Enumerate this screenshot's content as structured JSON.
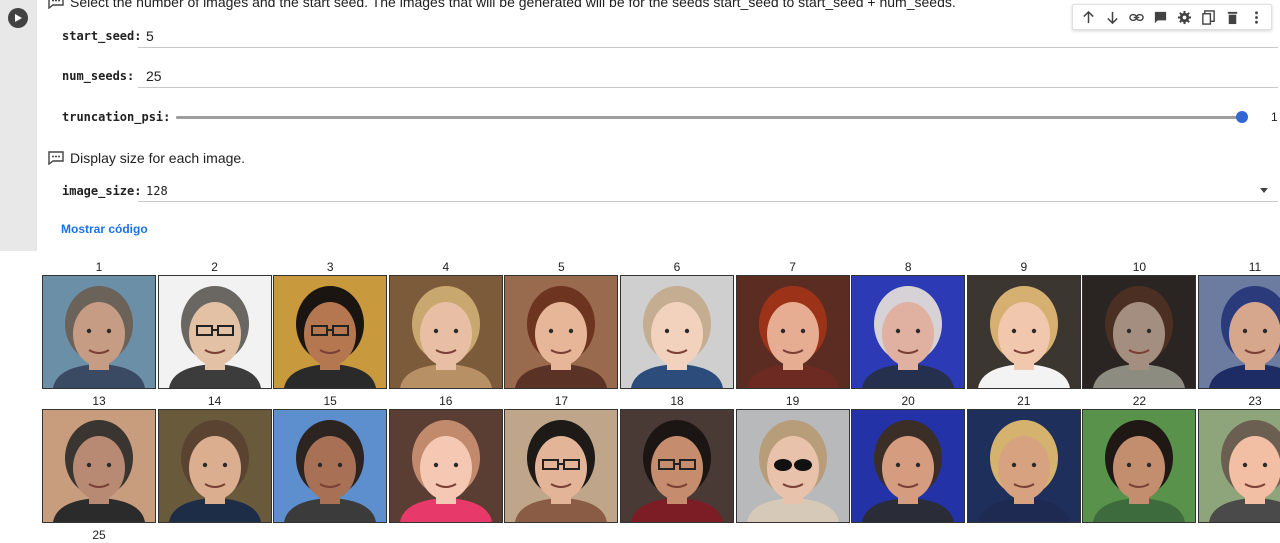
{
  "form": {
    "description_top": "Select the number of images and the start seed. The images that will be generated will be for the seeds start_seed to start_seed + num_seeds.",
    "start_seed_label": "start_seed:",
    "start_seed_value": "5",
    "num_seeds_label": "num_seeds:",
    "num_seeds_value": "25",
    "truncation_label": "truncation_psi:",
    "truncation_value": "1",
    "truncation_level": 1.0,
    "display_desc": "Display size for each image.",
    "image_size_label": "image_size:",
    "image_size_value": "128",
    "show_code": "Mostrar código"
  },
  "toolbar": {
    "icons": [
      "arrow-up-icon",
      "arrow-down-icon",
      "link-icon",
      "comment-icon",
      "settings-icon",
      "mirror-cell-icon",
      "delete-icon",
      "more-icon"
    ]
  },
  "images": {
    "row1": [
      {
        "label": "1",
        "skin": "#c79c84",
        "hair": "#6b6259",
        "bg": "#6c8fa8",
        "shirt": "#3a4a63"
      },
      {
        "label": "2",
        "skin": "#e2c1a4",
        "hair": "#6a6762",
        "bg": "#f2f2f2",
        "shirt": "#3c3c3c",
        "glasses": true
      },
      {
        "label": "3",
        "skin": "#b5774f",
        "hair": "#1b1512",
        "bg": "#c99a3d",
        "shirt": "#2a2a2a",
        "glasses": true
      },
      {
        "label": "4",
        "skin": "#e8bfa5",
        "hair": "#c9a870",
        "bg": "#7c5b3b",
        "shirt": "#b89065"
      },
      {
        "label": "5",
        "skin": "#e7b597",
        "hair": "#6d3520",
        "bg": "#9a6a4e",
        "shirt": "#5b3326"
      },
      {
        "label": "6",
        "skin": "#f2d2bd",
        "hair": "#c4ad90",
        "bg": "#cfcfcf",
        "shirt": "#2c4d7b"
      },
      {
        "label": "7",
        "skin": "#e6ad92",
        "hair": "#9c3318",
        "bg": "#5b2c22",
        "shirt": "#6c2a22"
      },
      {
        "label": "8",
        "skin": "#e0b0a0",
        "hair": "#d7d2d6",
        "bg": "#2c3ab5",
        "shirt": "#24304d"
      },
      {
        "label": "9",
        "skin": "#f1c7ad",
        "hair": "#d6b071",
        "bg": "#3c3630",
        "shirt": "#f3f3f3"
      },
      {
        "label": "10",
        "skin": "#a48e7f",
        "hair": "#4b2f22",
        "bg": "#2a2523",
        "shirt": "#8c8c80"
      },
      {
        "label": "11",
        "skin": "#d6a78c",
        "hair": "#2a3a7a",
        "bg": "#6c7ba0",
        "shirt": "#1e2c66"
      }
    ],
    "row2": [
      {
        "label": "13",
        "skin": "#b88a73",
        "hair": "#3b3531",
        "bg": "#c89d7e",
        "shirt": "#2b2b2b"
      },
      {
        "label": "14",
        "skin": "#dcae90",
        "hair": "#5b4332",
        "bg": "#6a5a3c",
        "shirt": "#1d2c47"
      },
      {
        "label": "15",
        "skin": "#a87156",
        "hair": "#2c2420",
        "bg": "#5d8fcf",
        "shirt": "#3b3b3b"
      },
      {
        "label": "16",
        "skin": "#f4c8b3",
        "hair": "#c28a6c",
        "bg": "#5a3d33",
        "shirt": "#e83a6a"
      },
      {
        "label": "17",
        "skin": "#e4b499",
        "hair": "#1e1a17",
        "bg": "#bfa58a",
        "shirt": "#8b5c45",
        "glasses": true
      },
      {
        "label": "18",
        "skin": "#c58d6e",
        "hair": "#1b1514",
        "bg": "#4a3a36",
        "shirt": "#7c1d25",
        "glasses": true
      },
      {
        "label": "19",
        "skin": "#e8c2aa",
        "hair": "#b89d7a",
        "bg": "#b7b9ba",
        "shirt": "#d6c9b8",
        "sunglasses": true
      },
      {
        "label": "20",
        "skin": "#d69c80",
        "hair": "#3b2e27",
        "bg": "#2332a6",
        "shirt": "#2a2c38"
      },
      {
        "label": "21",
        "skin": "#d7a280",
        "hair": "#d5b26d",
        "bg": "#1e2f5c",
        "shirt": "#1f2a52"
      },
      {
        "label": "22",
        "skin": "#c38e6d",
        "hair": "#1f1815",
        "bg": "#58924b",
        "shirt": "#3e6b3d"
      },
      {
        "label": "23",
        "skin": "#f2bfa4",
        "hair": "#6b5f52",
        "bg": "#8ea57c",
        "shirt": "#4a4a4a"
      }
    ],
    "row3": [
      {
        "label": "25"
      }
    ]
  }
}
